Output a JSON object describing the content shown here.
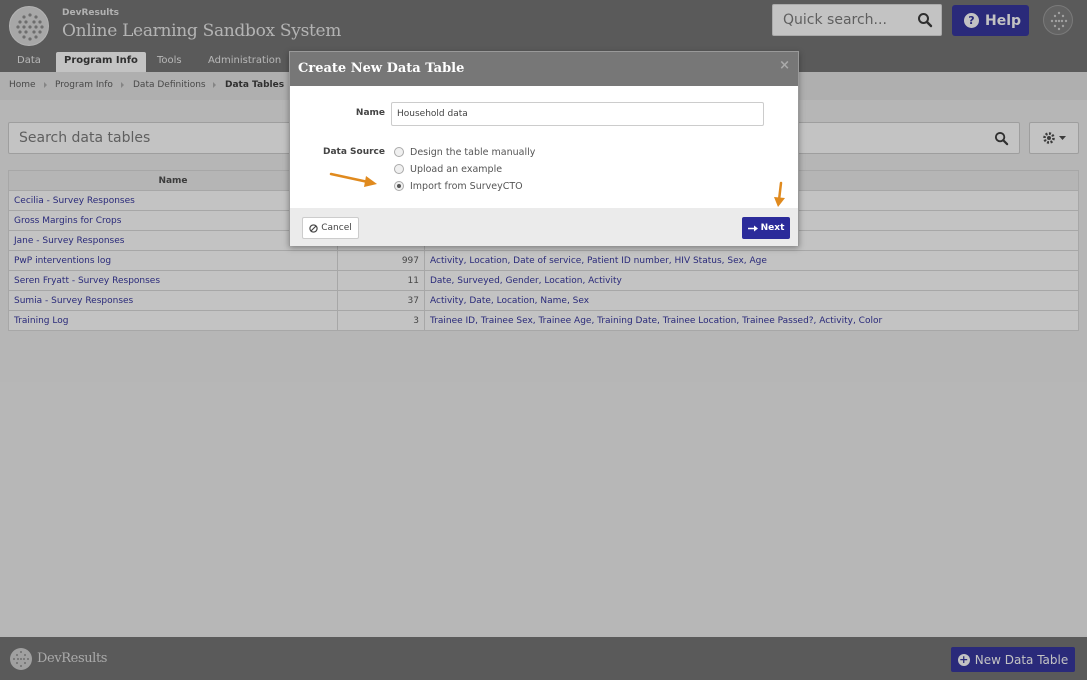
{
  "header": {
    "brand_small": "DevResults",
    "brand_title": "Online Learning Sandbox System",
    "quick_search_placeholder": "Quick search...",
    "help_label": "Help",
    "help_icon": "?"
  },
  "nav": {
    "items": [
      {
        "label": "Data"
      },
      {
        "label": "Program Info"
      },
      {
        "label": "Tools"
      },
      {
        "label": "Administration"
      }
    ]
  },
  "breadcrumb": [
    "Home",
    "Program Info",
    "Data Definitions",
    "Data Tables"
  ],
  "search": {
    "placeholder": "Search data tables"
  },
  "table": {
    "columns": [
      "Name"
    ],
    "rows": [
      {
        "name": "Cecilia - Survey Responses",
        "count": "",
        "fields": ""
      },
      {
        "name": "Gross Margins for Crops",
        "count": "",
        "fields": "s margin"
      },
      {
        "name": "Jane - Survey Responses",
        "count": "",
        "fields": ""
      },
      {
        "name": "PwP interventions log",
        "count": "997",
        "fields": "Activity, Location, Date of service, Patient ID number, HIV Status, Sex, Age"
      },
      {
        "name": "Seren Fryatt - Survey Responses",
        "count": "11",
        "fields": "Date, Surveyed, Gender, Location, Activity"
      },
      {
        "name": "Sumia - Survey Responses",
        "count": "37",
        "fields": "Activity, Date, Location, Name, Sex"
      },
      {
        "name": "Training Log",
        "count": "3",
        "fields": "Trainee ID, Trainee Sex, Trainee Age, Training Date, Trainee Location, Trainee Passed?, Activity, Color"
      }
    ]
  },
  "modal": {
    "title": "Create New Data Table",
    "close": "×",
    "name_label": "Name",
    "name_value": "Household data",
    "source_label": "Data Source",
    "options": [
      {
        "label": "Design the table manually",
        "checked": false
      },
      {
        "label": "Upload an example",
        "checked": false
      },
      {
        "label": "Import from SurveyCTO",
        "checked": true
      }
    ],
    "cancel_label": "Cancel",
    "next_label": "Next"
  },
  "footer": {
    "brand": "DevResults",
    "new_table_label": "New Data Table"
  },
  "colors": {
    "header_bg": "#6e6e6e",
    "accent_blue": "#2b2b9a",
    "annotation_arrow": "#e08a1e"
  }
}
